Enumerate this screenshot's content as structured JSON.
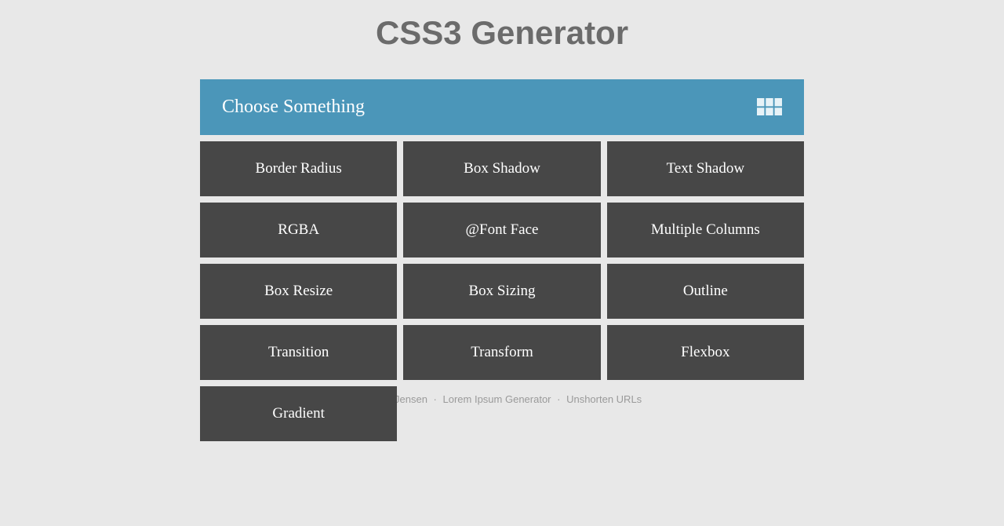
{
  "title": "CSS3 Generator",
  "dropdown": {
    "label": "Choose Something",
    "options": [
      "Border Radius",
      "Box Shadow",
      "Text Shadow",
      "RGBA",
      "@Font Face",
      "Multiple Columns",
      "Box Resize",
      "Box Sizing",
      "Outline",
      "Transition",
      "Transform",
      "Flexbox",
      "Gradient"
    ]
  },
  "footer": {
    "link1": "Randy Jensen",
    "link2": "Lorem Ipsum Generator",
    "link3": "Unshorten URLs"
  }
}
